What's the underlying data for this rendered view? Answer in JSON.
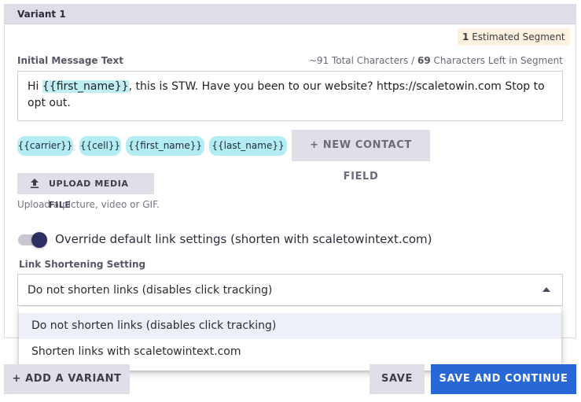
{
  "variant": {
    "header": "Variant 1"
  },
  "segment": {
    "count": "1",
    "label": "Estimated Segment"
  },
  "message": {
    "label": "Initial Message Text",
    "total_chars": "~91",
    "total_label": "Total Characters /",
    "left_chars": "69",
    "left_label": "Characters Left in Segment",
    "text_prefix": "Hi ",
    "text_token": "{{first_name}}",
    "text_suffix": ", this is STW. Have you been to our website? https://scaletowin.com Stop to opt out."
  },
  "contact_fields": {
    "chips": [
      "{{carrier}}",
      "{{cell}}",
      "{{first_name}}",
      "{{last_name}}"
    ],
    "new_button": "+ NEW CONTACT FIELD"
  },
  "upload": {
    "button_label": "UPLOAD MEDIA FILE",
    "icon": "upload-icon",
    "help": "Upload a picture, video or GIF."
  },
  "override_toggle": {
    "label": "Override default link settings (shorten with scaletowintext.com)",
    "on": true
  },
  "link_shortening": {
    "label": "Link Shortening Setting",
    "selected": "Do not shorten links (disables click tracking)",
    "options": [
      "Do not shorten links (disables click tracking)",
      "Shorten links with scaletowintext.com"
    ]
  },
  "footer": {
    "add_variant": "+ ADD A VARIANT",
    "save": "SAVE",
    "save_continue": "SAVE AND CONTINUE"
  },
  "colors": {
    "accent": "#2867d6",
    "chip": "#b4ecf4",
    "header_bg": "#dedde8",
    "toggle_knob": "#2f2e63"
  }
}
